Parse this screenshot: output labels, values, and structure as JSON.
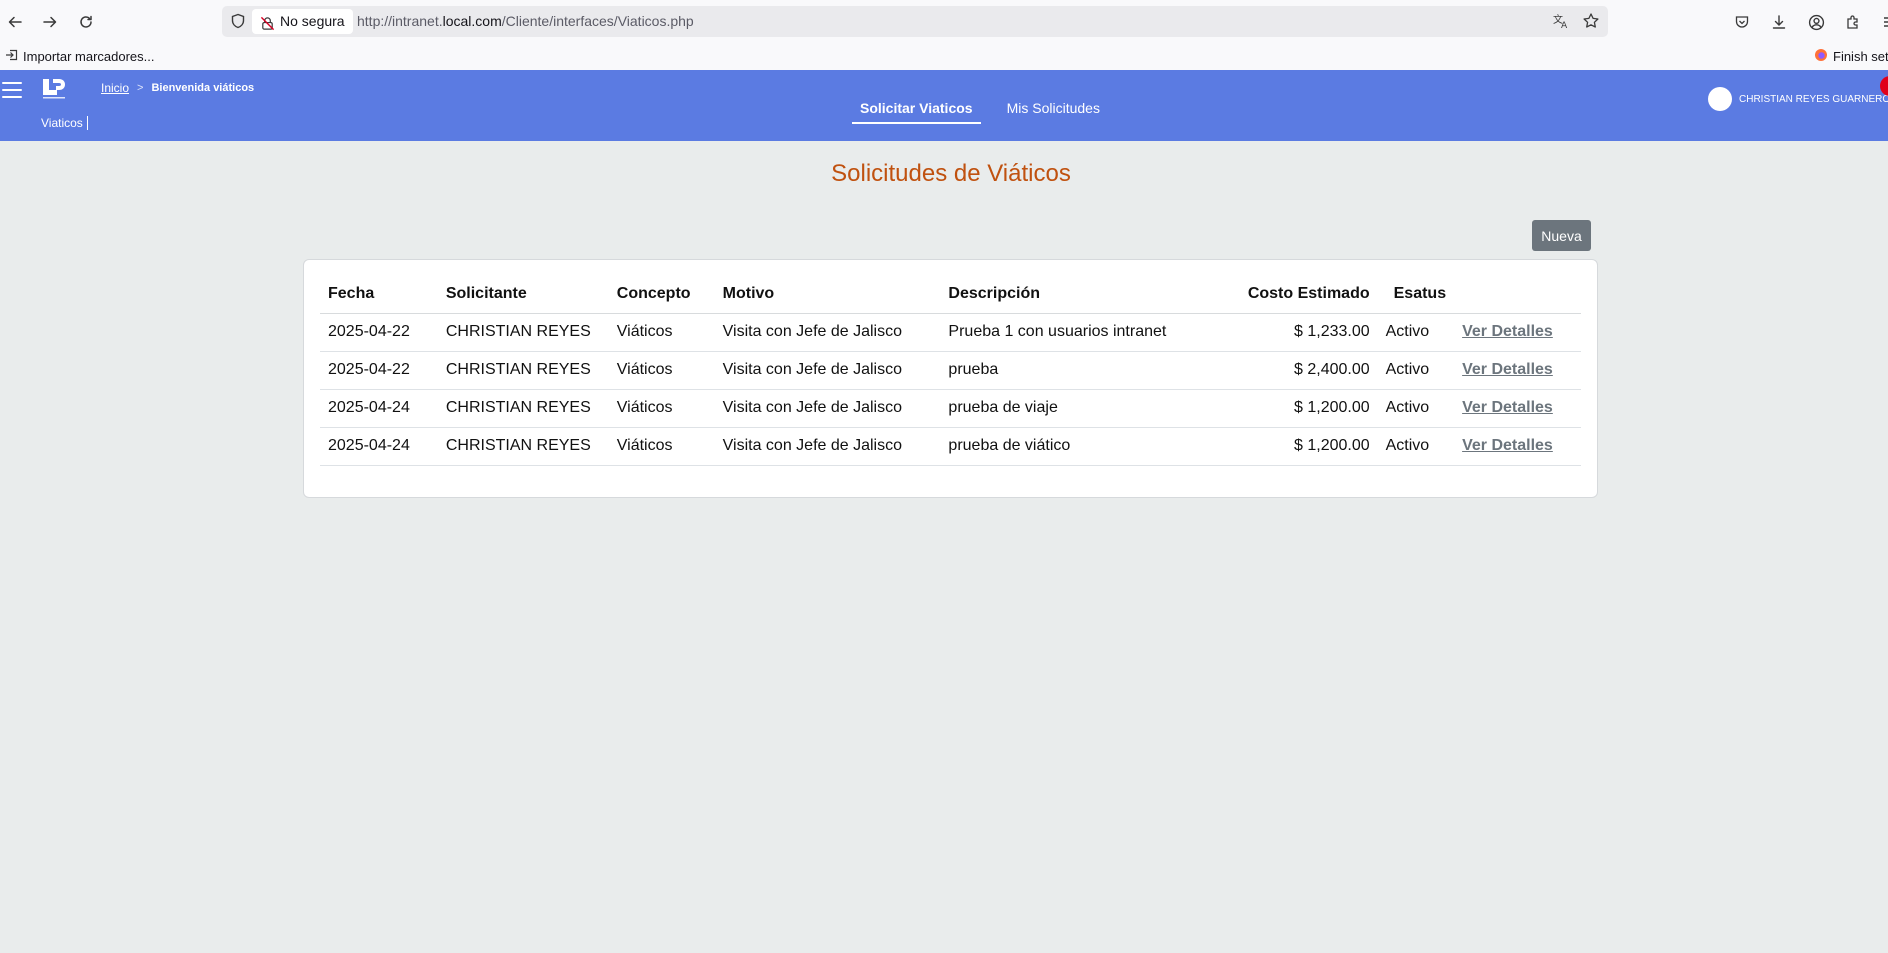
{
  "browser": {
    "security_label": "No segura",
    "url_prefix": "http://intranet.",
    "url_host": "local.com",
    "url_path": "/Cliente/interfaces/Viaticos.php",
    "bookmark_import": "Importar marcadores...",
    "bookmark_finish": "Finish setup"
  },
  "header": {
    "breadcrumb_home": "Inicio",
    "breadcrumb_current": "Bienvenida viáticos",
    "module_label": "Viaticos",
    "tabs": [
      {
        "label": "Solicitar Viaticos",
        "active": true
      },
      {
        "label": "Mis Solicitudes",
        "active": false
      }
    ],
    "user_name": "CHRISTIAN REYES GUARNEROS",
    "accent_color": "#5b7be2"
  },
  "main": {
    "title": "Solicitudes de Viáticos",
    "new_button": "Nueva",
    "table": {
      "headers": [
        "Fecha",
        "Solicitante",
        "Concepto",
        "Motivo",
        "Descripción",
        "Costo Estimado",
        "Esatus",
        ""
      ],
      "rows": [
        {
          "fecha": "2025-04-22",
          "solicitante": "CHRISTIAN REYES",
          "concepto": "Viáticos",
          "motivo": "Visita con Jefe de Jalisco",
          "descripcion": "Prueba 1 con usuarios intranet",
          "costo": "$ 1,233.00",
          "estatus": "Activo",
          "accion": "Ver Detalles"
        },
        {
          "fecha": "2025-04-22",
          "solicitante": "CHRISTIAN REYES",
          "concepto": "Viáticos",
          "motivo": "Visita con Jefe de Jalisco",
          "descripcion": "prueba",
          "costo": "$ 2,400.00",
          "estatus": "Activo",
          "accion": "Ver Detalles"
        },
        {
          "fecha": "2025-04-24",
          "solicitante": "CHRISTIAN REYES",
          "concepto": "Viáticos",
          "motivo": "Visita con Jefe de Jalisco",
          "descripcion": "prueba de viaje",
          "costo": "$ 1,200.00",
          "estatus": "Activo",
          "accion": "Ver Detalles"
        },
        {
          "fecha": "2025-04-24",
          "solicitante": "CHRISTIAN REYES",
          "concepto": "Viáticos",
          "motivo": "Visita con Jefe de Jalisco",
          "descripcion": "prueba de viático",
          "costo": "$ 1,200.00",
          "estatus": "Activo",
          "accion": "Ver Detalles"
        }
      ]
    }
  }
}
